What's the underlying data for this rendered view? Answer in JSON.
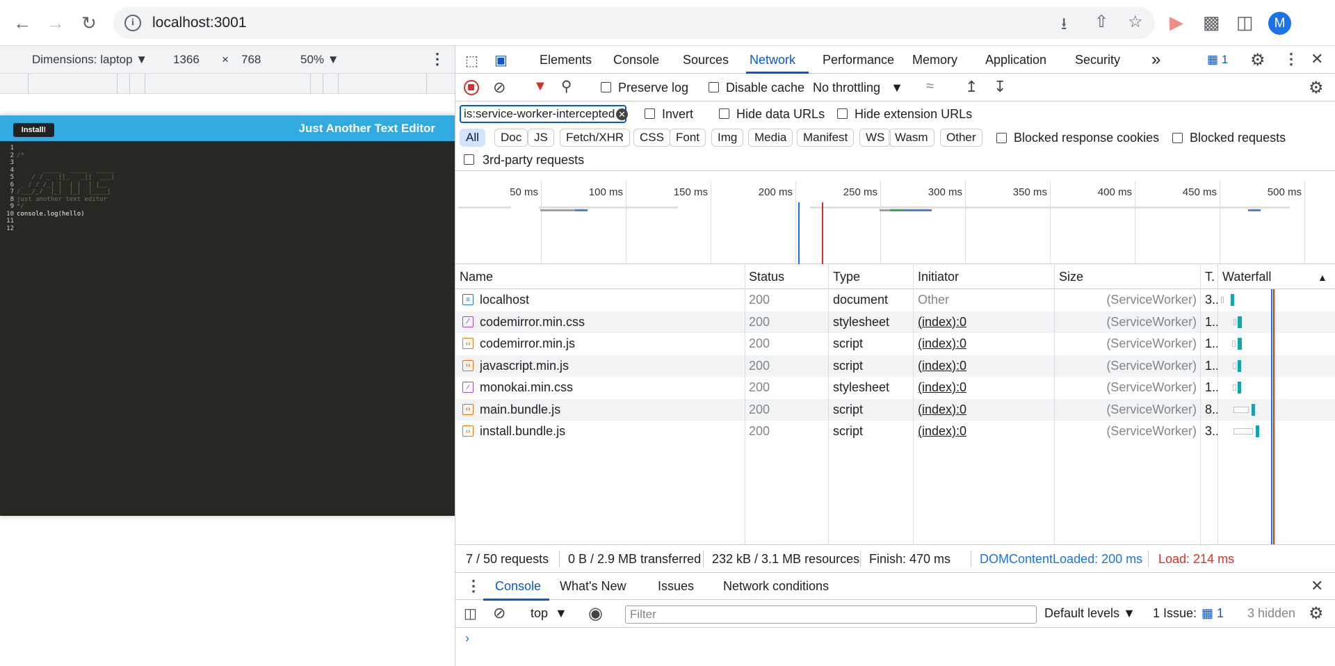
{
  "browser": {
    "url": "localhost:3001",
    "profile_initial": "M"
  },
  "device_toolbar": {
    "dimensions_label": "Dimensions: laptop",
    "width": "1366",
    "times": "×",
    "height": "768",
    "zoom": "50%"
  },
  "app": {
    "install_label": "Install!",
    "title": "Just Another Text Editor",
    "lines": [
      {
        "n": "1",
        "text": "",
        "kind": "code"
      },
      {
        "n": "2",
        "text": "/*",
        "kind": "comment"
      },
      {
        "n": "3",
        "text": "",
        "kind": "comment"
      },
      {
        "n": "4",
        "text": "       _____  _____  _____",
        "kind": "comment"
      },
      {
        "n": "5",
        "text": "    / / _  ||_   _||  ___|",
        "kind": "comment"
      },
      {
        "n": "6",
        "text": " _ / / /_| |  | |  | |__",
        "kind": "comment"
      },
      {
        "n": "7",
        "text": "/___/_/  |_|  |_|  |____|",
        "kind": "comment"
      },
      {
        "n": "8",
        "text": "just another text editor",
        "kind": "comment"
      },
      {
        "n": "9",
        "text": "*/",
        "kind": "comment"
      },
      {
        "n": "10",
        "text": "console.log(hello)",
        "kind": "code"
      },
      {
        "n": "11",
        "text": "",
        "kind": "code"
      },
      {
        "n": "12",
        "text": "",
        "kind": "code"
      }
    ]
  },
  "devtools": {
    "tabs": [
      "Elements",
      "Console",
      "Sources",
      "Network",
      "Performance",
      "Memory",
      "Application",
      "Security"
    ],
    "more_tabs": "»",
    "issues_count": "1",
    "toolbar": {
      "preserve_log": "Preserve log",
      "disable_cache": "Disable cache",
      "throttling": "No throttling"
    },
    "filter": {
      "value": "is:service-worker-intercepted",
      "invert": "Invert",
      "hide_data_urls": "Hide data URLs",
      "hide_extension_urls": "Hide extension URLs"
    },
    "types": [
      "All",
      "Doc",
      "JS",
      "Fetch/XHR",
      "CSS",
      "Font",
      "Img",
      "Media",
      "Manifest",
      "WS",
      "Wasm",
      "Other"
    ],
    "blocked_response_cookies": "Blocked response cookies",
    "blocked_requests": "Blocked requests",
    "third_party": "3rd-party requests",
    "timeline_ticks": [
      "50 ms",
      "100 ms",
      "150 ms",
      "200 ms",
      "250 ms",
      "300 ms",
      "350 ms",
      "400 ms",
      "450 ms",
      "500 ms"
    ],
    "columns": {
      "name": "Name",
      "status": "Status",
      "type": "Type",
      "initiator": "Initiator",
      "size": "Size",
      "time": "T.",
      "waterfall": "Waterfall"
    },
    "requests": [
      {
        "name": "localhost",
        "status": "200",
        "type": "document",
        "initiator": "Other",
        "size": "(ServiceWorker)",
        "time": "3..",
        "icon": "doc"
      },
      {
        "name": "codemirror.min.css",
        "status": "200",
        "type": "stylesheet",
        "initiator": "(index):0",
        "size": "(ServiceWorker)",
        "time": "1..",
        "icon": "css"
      },
      {
        "name": "codemirror.min.js",
        "status": "200",
        "type": "script",
        "initiator": "(index):0",
        "size": "(ServiceWorker)",
        "time": "1..",
        "icon": "js"
      },
      {
        "name": "javascript.min.js",
        "status": "200",
        "type": "script",
        "initiator": "(index):0",
        "size": "(ServiceWorker)",
        "time": "1..",
        "icon": "js"
      },
      {
        "name": "monokai.min.css",
        "status": "200",
        "type": "stylesheet",
        "initiator": "(index):0",
        "size": "(ServiceWorker)",
        "time": "1..",
        "icon": "css"
      },
      {
        "name": "main.bundle.js",
        "status": "200",
        "type": "script",
        "initiator": "(index):0",
        "size": "(ServiceWorker)",
        "time": "8..",
        "icon": "js"
      },
      {
        "name": "install.bundle.js",
        "status": "200",
        "type": "script",
        "initiator": "(index):0",
        "size": "(ServiceWorker)",
        "time": "3..",
        "icon": "js"
      }
    ],
    "status": {
      "requests": "7 / 50 requests",
      "transferred": "0 B / 2.9 MB transferred",
      "resources": "232 kB / 3.1 MB resources",
      "finish": "Finish: 470 ms",
      "dcl": "DOMContentLoaded: 200 ms",
      "load": "Load: 214 ms"
    },
    "drawer_tabs": [
      "Console",
      "What's New",
      "Issues",
      "Network conditions"
    ],
    "console": {
      "context": "top",
      "filter_placeholder": "Filter",
      "levels": "Default levels",
      "issues_label": "1 Issue:",
      "issues_count": "1",
      "hidden": "3 hidden"
    }
  }
}
